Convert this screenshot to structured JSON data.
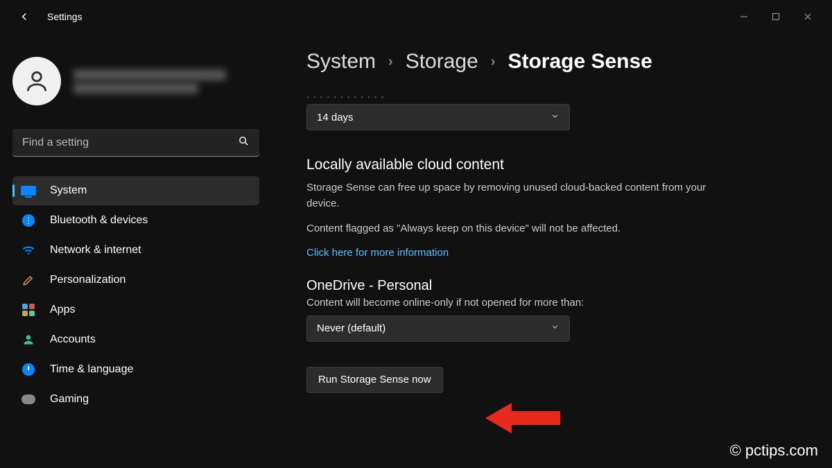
{
  "titlebar": {
    "app_name": "Settings"
  },
  "search": {
    "placeholder": "Find a setting"
  },
  "nav": {
    "items": [
      {
        "label": "System"
      },
      {
        "label": "Bluetooth & devices"
      },
      {
        "label": "Network & internet"
      },
      {
        "label": "Personalization"
      },
      {
        "label": "Apps"
      },
      {
        "label": "Accounts"
      },
      {
        "label": "Time & language"
      },
      {
        "label": "Gaming"
      }
    ]
  },
  "breadcrumb": {
    "a": "System",
    "b": "Storage",
    "c": "Storage Sense"
  },
  "dropdown1": {
    "value": "14 days"
  },
  "cloud": {
    "heading": "Locally available cloud content",
    "p1": "Storage Sense can free up space by removing unused cloud-backed content from your device.",
    "p2": "Content flagged as \"Always keep on this device\" will not be affected.",
    "link": "Click here for more information"
  },
  "onedrive": {
    "heading": "OneDrive - Personal",
    "desc": "Content will become online-only if not opened for more than:",
    "value": "Never (default)"
  },
  "run_button": "Run Storage Sense now",
  "watermark": "© pctips.com"
}
